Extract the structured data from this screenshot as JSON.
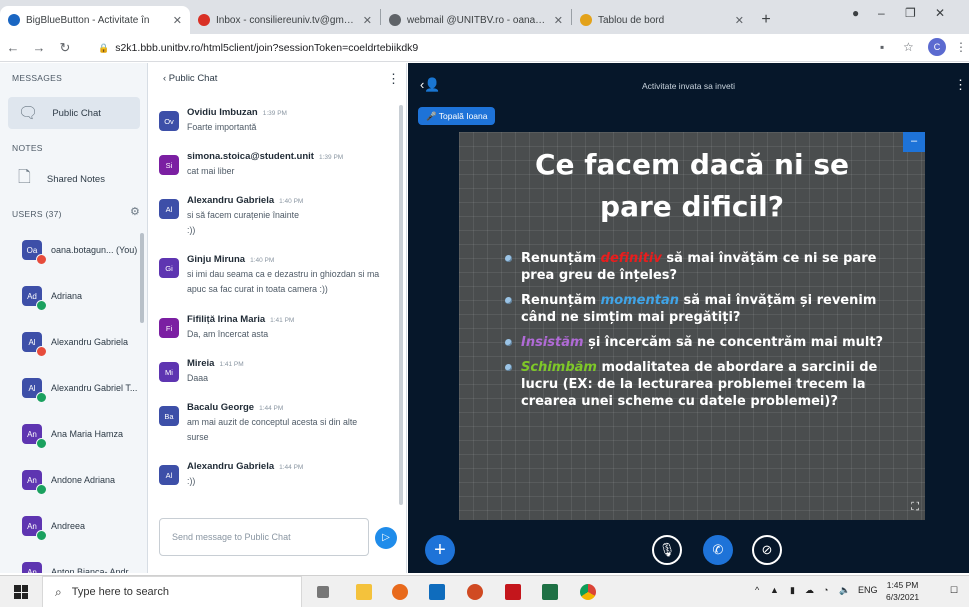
{
  "browser": {
    "tabs": [
      {
        "title": "BigBlueButton - Activitate în",
        "close": "✕",
        "color": "#1a66c2",
        "active": true
      },
      {
        "title": "Inbox - consiliereuniv.tv@gmail.c",
        "close": "✕",
        "color": "#d93025",
        "active": false
      },
      {
        "title": "webmail @UNITBV.ro - oana.bot",
        "close": "✕",
        "color": "#5f6368",
        "active": false
      },
      {
        "title": "Tablou de bord",
        "close": "✕",
        "color": "#e3a21a",
        "active": false
      }
    ],
    "new_tab": "+",
    "url": "s2k1.bbb.unitbv.ro/html5client/join?sessionToken=coeldrtebiikdk9",
    "profile_initial": "C"
  },
  "left_panel": {
    "messages_header": "MESSAGES",
    "public_chat": "Public Chat",
    "notes_header": "NOTES",
    "shared_notes": "Shared Notes",
    "users_header": "USERS (37)",
    "users": [
      {
        "initials": "Oa",
        "name": "oana.botagun... (You)",
        "color": "#3d4fa8",
        "status": "red"
      },
      {
        "initials": "Ad",
        "name": "Adriana",
        "color": "#3d4fa8",
        "status": "green"
      },
      {
        "initials": "Al",
        "name": "Alexandru Gabriela",
        "color": "#3d4fa8",
        "status": "red"
      },
      {
        "initials": "Al",
        "name": "Alexandru Gabriel T...",
        "color": "#3d4fa8",
        "status": "green"
      },
      {
        "initials": "An",
        "name": "Ana Maria Hamza",
        "color": "#5e35b1",
        "status": "green"
      },
      {
        "initials": "An",
        "name": "Andone Adriana",
        "color": "#5e35b1",
        "status": "green"
      },
      {
        "initials": "An",
        "name": "Andreea",
        "color": "#5e35b1",
        "status": "green"
      },
      {
        "initials": "An",
        "name": "Anton Bianca- Andr...",
        "color": "#5e35b1",
        "status": "green"
      }
    ]
  },
  "chat": {
    "back_label": "‹  Public Chat",
    "messages": [
      {
        "initials": "Ov",
        "color": "#3d4fa8",
        "name": "Ovidiu Imbuzan",
        "time": "1:39 PM",
        "lines": [
          "Foarte importantă"
        ]
      },
      {
        "initials": "Si",
        "color": "#7b1fa2",
        "name": "simona.stoica@student.unit",
        "time": "1:39 PM",
        "lines": [
          "cat mai liber"
        ]
      },
      {
        "initials": "Al",
        "color": "#3d4fa8",
        "name": "Alexandru Gabriela",
        "time": "1:40 PM",
        "lines": [
          "si să facem curațenie înainte",
          ":))"
        ]
      },
      {
        "initials": "Gi",
        "color": "#5e35b1",
        "name": "Ginju Miruna",
        "time": "1:40 PM",
        "lines": [
          "si imi dau seama ca e dezastru in ghiozdan si ma",
          "apuc sa fac curat in toata camera :))"
        ]
      },
      {
        "initials": "Fi",
        "color": "#7b1fa2",
        "name": "Fifiliță Irina Maria",
        "time": "1:41 PM",
        "lines": [
          "Da, am încercat asta"
        ]
      },
      {
        "initials": "Mi",
        "color": "#5e35b1",
        "name": "Mireia",
        "time": "1:41 PM",
        "lines": [
          "Daaa"
        ]
      },
      {
        "initials": "Ba",
        "color": "#3d4fa8",
        "name": "Bacalu George",
        "time": "1:44 PM",
        "lines": [
          "am mai auzit de conceptul acesta si din alte",
          "surse"
        ]
      },
      {
        "initials": "Al",
        "color": "#3d4fa8",
        "name": "Alexandru Gabriela",
        "time": "1:44 PM",
        "lines": [
          ":))"
        ]
      }
    ],
    "input_placeholder": "Send message to Public Chat",
    "send_icon": "▷"
  },
  "presentation": {
    "title": "Activitate invata sa inveti",
    "presenter": "Topală Ioana",
    "slide_title_line1": "Ce facem dacă ni se",
    "slide_title_line2": "pare dificil?",
    "bullets": [
      {
        "emph": "definitiv",
        "emph_color": "red",
        "before": "Renunțăm ",
        "after": " să mai învățăm ce ni se pare prea greu de înțeles?"
      },
      {
        "emph": "momentan",
        "emph_color": "blue",
        "before": "Renunțăm ",
        "after": " să mai învățăm și revenim când ne simțim mai pregătiți?"
      },
      {
        "emph": "Insistăm",
        "emph_color": "purple",
        "before": "",
        "after": " și încercăm să ne concentrăm mai mult?"
      },
      {
        "emph": "Schimbăm",
        "emph_color": "green",
        "before": "",
        "after": " modalitatea de abordare a sarcinii de lucru (EX: de la lecturarea problemei trecem la crearea unei scheme cu datele problemei)?"
      }
    ]
  },
  "taskbar": {
    "search_placeholder": "Type here to search",
    "language": "ENG",
    "time": "1:45 PM",
    "date": "6/3/2021"
  }
}
